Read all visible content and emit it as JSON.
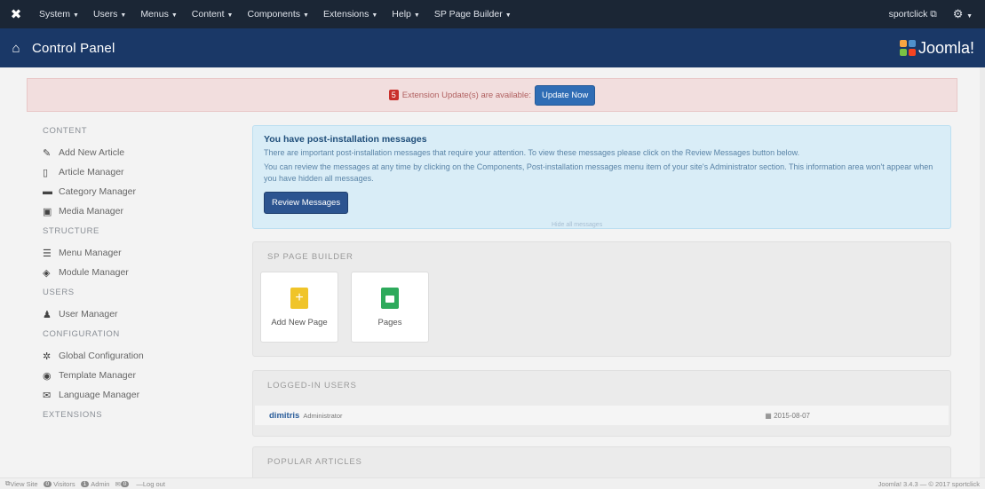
{
  "navbar": {
    "menu": [
      "System",
      "Users",
      "Menus",
      "Content",
      "Components",
      "Extensions",
      "Help",
      "SP Page Builder"
    ],
    "site_link": "sportclick",
    "site_link_icon": "external-link-icon",
    "settings_icon": "gear-icon"
  },
  "titlebar": {
    "title": "Control Panel",
    "brand": "Joomla!"
  },
  "alert": {
    "badge": "5",
    "text": "Extension Update(s) are available:",
    "button": "Update Now"
  },
  "sidebar": {
    "content_heading": "CONTENT",
    "content_items": [
      "Add New Article",
      "Article Manager",
      "Category Manager",
      "Media Manager"
    ],
    "structure_heading": "STRUCTURE",
    "structure_items": [
      "Menu Manager",
      "Module Manager"
    ],
    "users_heading": "USERS",
    "users_items": [
      "User Manager"
    ],
    "configuration_heading": "CONFIGURATION",
    "configuration_items": [
      "Global Configuration",
      "Template Manager",
      "Language Manager"
    ],
    "extensions_heading": "EXTENSIONS"
  },
  "postinstall": {
    "title": "You have post-installation messages",
    "line1": "There are important post-installation messages that require your attention. To view these messages please click on the Review Messages button below.",
    "line2": "You can review the messages at any time by clicking on the Components, Post-installation messages menu item of your site's Administrator section. This information area won't appear when you have hidden all messages.",
    "button": "Review Messages",
    "hint": "Hide all messages"
  },
  "sp_builder": {
    "heading": "SP PAGE BUILDER",
    "tiles": [
      "Add New Page",
      "Pages"
    ]
  },
  "logged_users": {
    "heading": "LOGGED-IN USERS",
    "user": "dimitris",
    "role": "Administrator",
    "date": "2015-08-07"
  },
  "popular": {
    "heading": "POPULAR ARTICLES"
  },
  "footer": {
    "view_site": "View Site",
    "visitors_count": "0",
    "visitors_label": "Visitors",
    "admin_count": "1",
    "admin_label": "Admin",
    "messages_count": "0",
    "logout": "Log out",
    "version": "Joomla! 3.4.3 — © 2017 sportclick"
  },
  "colors": {
    "navbar": "#1b2635",
    "titlebar": "#1a3867",
    "alert_bg": "#f2dede",
    "primary_button": "#2f6db5",
    "info_bg": "#d9edf7",
    "tile_add": "#f0c429",
    "tile_pages": "#2eaa5c"
  }
}
